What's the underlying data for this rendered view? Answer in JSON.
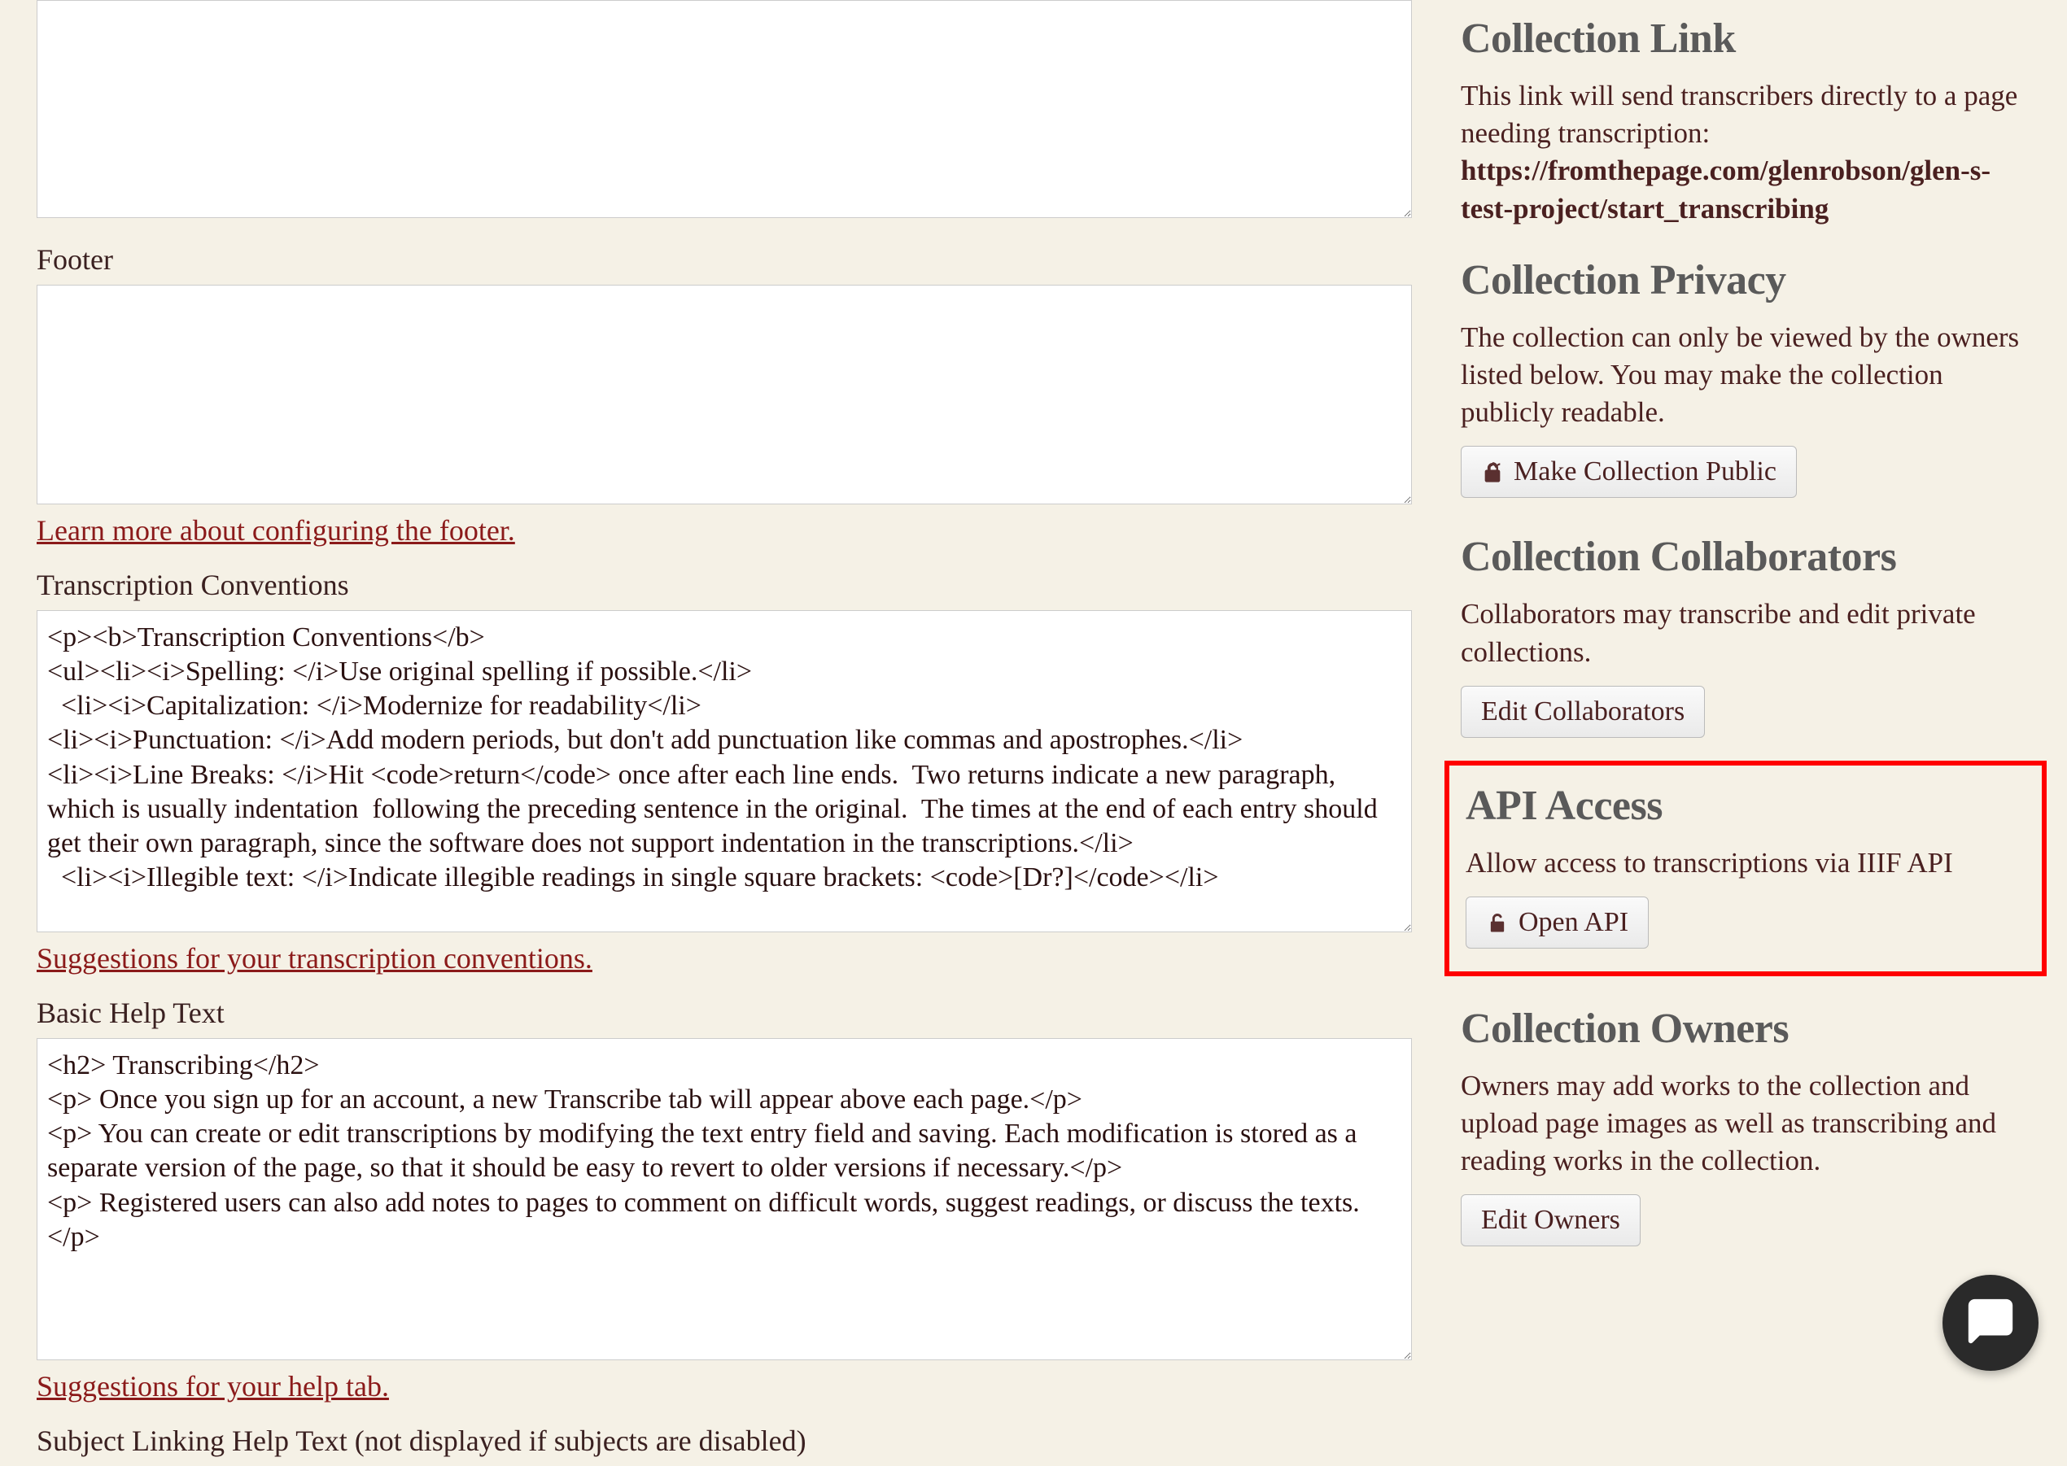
{
  "main": {
    "description_value": "",
    "footer_label": "Footer",
    "footer_value": "",
    "footer_link": "Learn more about configuring the footer.",
    "conventions_label": "Transcription Conventions",
    "conventions_value": "<p><b>Transcription Conventions</b>\n<ul><li><i>Spelling: </i>Use original spelling if possible.</li>\n  <li><i>Capitalization: </i>Modernize for readability</li>\n<li><i>Punctuation: </i>Add modern periods, but don't add punctuation like commas and apostrophes.</li>\n<li><i>Line Breaks: </i>Hit <code>return</code> once after each line ends.  Two returns indicate a new paragraph, which is usually indentation  following the preceding sentence in the original.  The times at the end of each entry should get their own paragraph, since the software does not support indentation in the transcriptions.</li>\n  <li><i>Illegible text: </i>Indicate illegible readings in single square brackets: <code>[Dr?]</code></li>",
    "conventions_link": "Suggestions for your transcription conventions.",
    "basic_help_label": "Basic Help Text",
    "basic_help_value": "<h2> Transcribing</h2>\n<p> Once you sign up for an account, a new Transcribe tab will appear above each page.</p>\n<p> You can create or edit transcriptions by modifying the text entry field and saving. Each modification is stored as a separate version of the page, so that it should be easy to revert to older versions if necessary.</p>\n<p> Registered users can also add notes to pages to comment on difficult words, suggest readings, or discuss the texts.</p>",
    "basic_help_link": "Suggestions for your help tab.",
    "subject_help_label": "Subject Linking Help Text (not displayed if subjects are disabled)"
  },
  "sidebar": {
    "link_heading": "Collection Link",
    "link_text_prefix": "This link will send transcribers directly to a page needing transcription: ",
    "link_url": "https://fromthepage.com/glenrobson/glen-s-test-project/start_transcribing",
    "privacy_heading": "Collection Privacy",
    "privacy_text": "The collection can only be viewed by the owners listed below. You may make the collection publicly readable.",
    "privacy_button": "Make Collection Public",
    "collaborators_heading": "Collection Collaborators",
    "collaborators_text": "Collaborators may transcribe and edit private collections.",
    "collaborators_button": "Edit Collaborators",
    "api_heading": "API Access",
    "api_text": "Allow access to transcriptions via IIIF API",
    "api_button": "Open API",
    "owners_heading": "Collection Owners",
    "owners_text": "Owners may add works to the collection and upload page images as well as transcribing and reading works in the collection.",
    "owners_button": "Edit Owners"
  }
}
